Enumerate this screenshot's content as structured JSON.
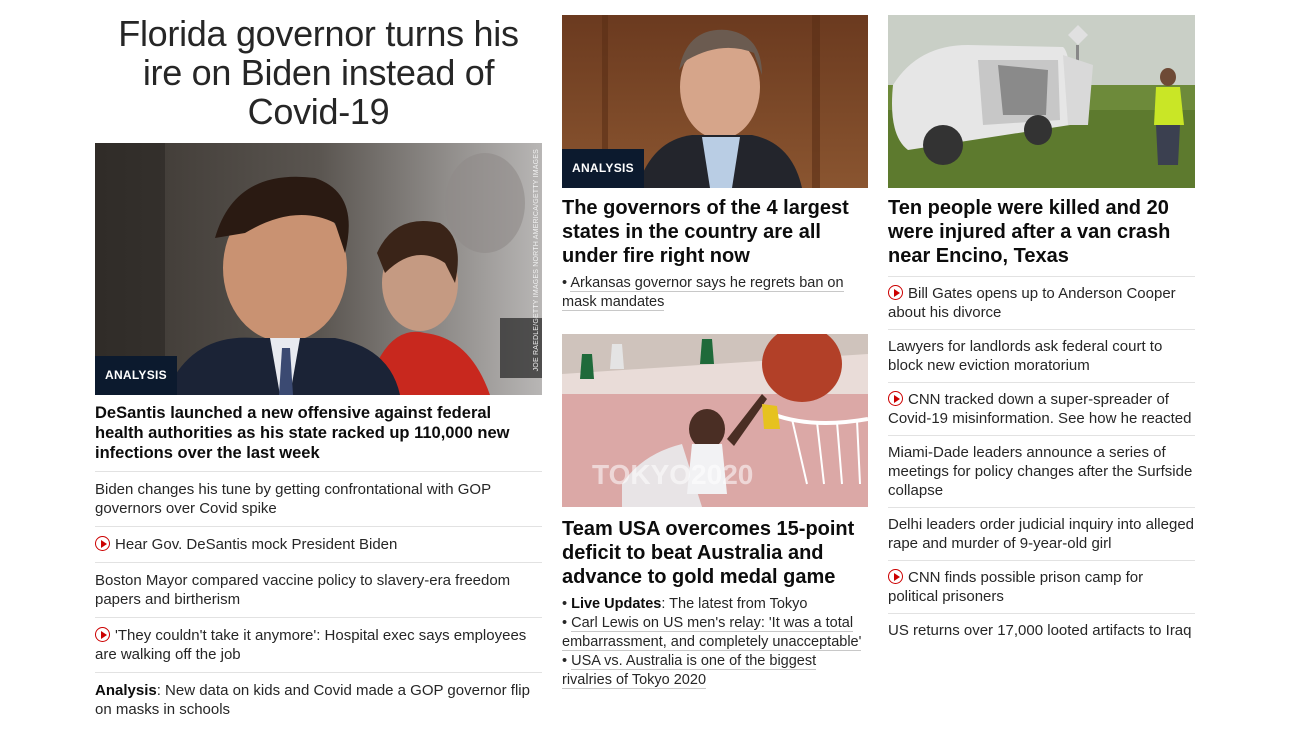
{
  "col1": {
    "headline": "Florida governor turns his ire on Biden instead of Covid-19",
    "image_badge": "ANALYSIS",
    "image_credit": "Joe Raedle/Getty Images North America/Getty Images",
    "story_title": "DeSantis launched a new offensive against federal health authorities as his state racked up 110,000 new infections over the last week",
    "links": [
      {
        "video": false,
        "prefix": "",
        "text": "Biden changes his tune by getting confrontational with GOP governors over Covid spike"
      },
      {
        "video": true,
        "prefix": "",
        "text": "Hear Gov. DeSantis mock President Biden"
      },
      {
        "video": false,
        "prefix": "",
        "text": "Boston Mayor compared vaccine policy to slavery-era freedom papers and birtherism"
      },
      {
        "video": true,
        "prefix": "",
        "text": "'They couldn't take it anymore': Hospital exec says employees are walking off the job"
      },
      {
        "video": false,
        "prefix": "Analysis",
        "text": ": New data on kids and Covid made a GOP governor flip on masks in schools"
      }
    ]
  },
  "col2": {
    "story1": {
      "image_badge": "ANALYSIS",
      "title": "The governors of the 4 largest states in the country are all under fire right now",
      "sublinks": [
        "Arkansas governor says he regrets ban on mask mandates"
      ]
    },
    "story2": {
      "title": "Team USA overcomes 15-point deficit to beat Australia and advance to gold medal game",
      "live_label": "Live Updates",
      "live_text": ": The latest from Tokyo",
      "sublinks": [
        "Carl Lewis on US men's relay: 'It was a total embarrassment, and completely unacceptable'",
        "USA vs. Australia is one of the biggest rivalries of Tokyo 2020"
      ],
      "court_text": "TOKYO2020"
    }
  },
  "col3": {
    "title": "Ten people were killed and 20 were injured after a van crash near Encino, Texas",
    "links": [
      {
        "video": true,
        "text": "Bill Gates opens up to Anderson Cooper about his divorce"
      },
      {
        "video": false,
        "text": "Lawyers for landlords ask federal court to block new eviction moratorium"
      },
      {
        "video": true,
        "text": "CNN tracked down a super-spreader of Covid-19 misinformation. See how he reacted"
      },
      {
        "video": false,
        "text": "Miami-Dade leaders announce a series of meetings for policy changes after the Surfside collapse"
      },
      {
        "video": false,
        "text": "Delhi leaders order judicial inquiry into alleged rape and murder of 9-year-old girl"
      },
      {
        "video": true,
        "text": "CNN finds possible prison camp for political prisoners"
      },
      {
        "video": false,
        "text": "US returns over 17,000 looted artifacts to Iraq"
      }
    ]
  }
}
